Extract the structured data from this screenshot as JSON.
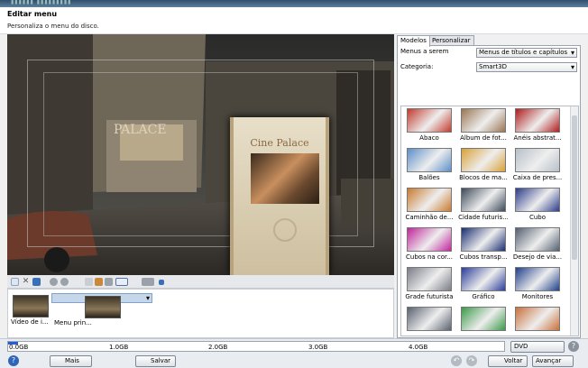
{
  "window": {
    "title": "Editar menu",
    "subtitle": "Personaliza o menu do disco."
  },
  "preview": {
    "card_title": "Cine Palace"
  },
  "scenes": [
    {
      "label": "Vídeo de i..."
    },
    {
      "label": "Menu prin..."
    }
  ],
  "right": {
    "tabs": [
      {
        "label": "Modelos"
      },
      {
        "label": "Personalizar"
      }
    ],
    "menus_label": "Menus a serem",
    "menus_value": "Menus de títulos e capítulos",
    "category_label": "Categoria:",
    "category_value": "Smart3D",
    "templates": [
      {
        "name": "Ábaco",
        "color": "#c23b2e"
      },
      {
        "name": "Álbum de fot...",
        "color": "#9a7654"
      },
      {
        "name": "Anéis abstrat...",
        "color": "#b01c1c"
      },
      {
        "name": "Balões",
        "color": "#5d8fc7"
      },
      {
        "name": "Blocos de ma...",
        "color": "#d9a037"
      },
      {
        "name": "Caixa de pres...",
        "color": "#b7c0c8"
      },
      {
        "name": "Caminhão de...",
        "color": "#c97a2f"
      },
      {
        "name": "Cidade futuris...",
        "color": "#3d4a5a"
      },
      {
        "name": "Cubo",
        "color": "#2c3c8a"
      },
      {
        "name": "Cubos na cor...",
        "color": "#c0259a"
      },
      {
        "name": "Cubos transp...",
        "color": "#1a2e70"
      },
      {
        "name": "Desejo de via...",
        "color": "#536070"
      },
      {
        "name": "Grade futurista",
        "color": "#7a7d88"
      },
      {
        "name": "Gráfico",
        "color": "#2b3d9a"
      },
      {
        "name": "Monitores",
        "color": "#20408a"
      },
      {
        "name": "",
        "color": "#5a6270"
      },
      {
        "name": "",
        "color": "#3b9a4a"
      },
      {
        "name": "",
        "color": "#c8703a"
      }
    ]
  },
  "capacity": {
    "ticks": [
      "0.0GB",
      "1.0GB",
      "2.0GB",
      "3.0GB",
      "4.0GB"
    ],
    "used_fraction": 0.02,
    "disc": "DVD"
  },
  "buttons": {
    "more": "Mais >>",
    "save": "Salvar",
    "back": "Voltar",
    "next": "Avançar"
  }
}
